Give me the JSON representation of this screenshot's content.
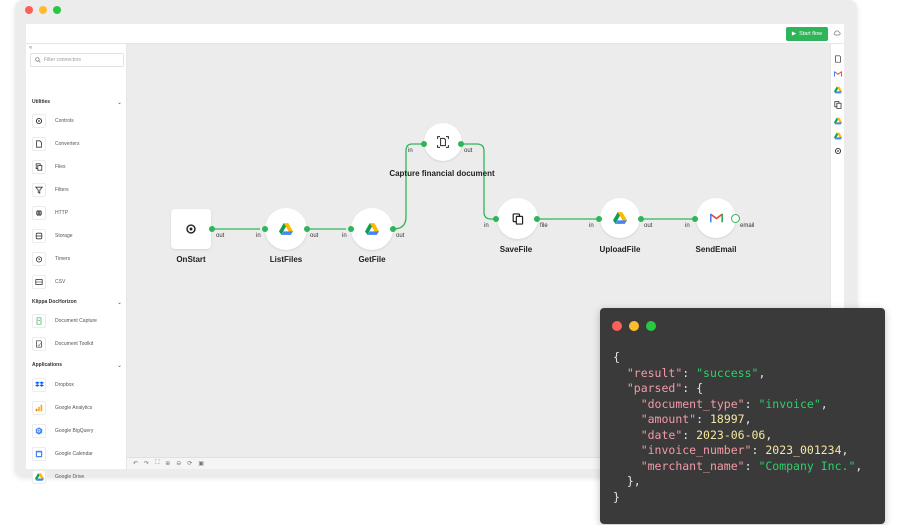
{
  "header": {
    "start_label": "Start flow"
  },
  "sidebar": {
    "search_placeholder": "Filter connectors",
    "sections": [
      {
        "label": "Utilities",
        "items": [
          {
            "label": "Controls",
            "icon": "gear-icon"
          },
          {
            "label": "Converters",
            "icon": "document-convert-icon"
          },
          {
            "label": "Files",
            "icon": "files-icon"
          },
          {
            "label": "Filters",
            "icon": "filter-icon"
          },
          {
            "label": "HTTP",
            "icon": "globe-icon"
          },
          {
            "label": "Storage",
            "icon": "database-icon"
          },
          {
            "label": "Timers",
            "icon": "clock-icon"
          },
          {
            "label": "CSV",
            "icon": "csv-icon"
          }
        ]
      },
      {
        "label": "Klippa DocHorizon",
        "items": [
          {
            "label": "Document Capture",
            "icon": "document-capture-icon"
          },
          {
            "label": "Document Toolkit",
            "icon": "document-toolkit-icon"
          }
        ]
      },
      {
        "label": "Applications",
        "items": [
          {
            "label": "Dropbox",
            "icon": "dropbox-icon"
          },
          {
            "label": "Google Analytics",
            "icon": "google-analytics-icon"
          },
          {
            "label": "Google BigQuery",
            "icon": "google-bigquery-icon"
          },
          {
            "label": "Google Calendar",
            "icon": "google-calendar-icon"
          },
          {
            "label": "Google Drive",
            "icon": "google-drive-icon"
          }
        ]
      }
    ]
  },
  "flow": {
    "nodes": {
      "onstart": {
        "title": "OnStart",
        "out": "out"
      },
      "listfiles": {
        "title": "ListFiles",
        "in": "in",
        "out": "out"
      },
      "getfile": {
        "title": "GetFile",
        "in": "in",
        "out": "out"
      },
      "capture": {
        "title": "Capture financial document",
        "in": "in",
        "out": "out"
      },
      "savefile": {
        "title": "SaveFile",
        "in": "in",
        "out": "file"
      },
      "uploadfile": {
        "title": "UploadFile",
        "in": "in",
        "out": "out"
      },
      "sendemail": {
        "title": "SendEmail",
        "in": "in",
        "out": "email"
      }
    },
    "colors": {
      "accent": "#2fb45a"
    }
  },
  "code": {
    "lines": [
      "{",
      "  \"result\": \"success\",",
      "  \"parsed\": {",
      "    \"document_type\": \"invoice\",",
      "    \"amount\": 18997,",
      "    \"date\": 2023-06-06,",
      "    \"invoice_number\": 2023_001234,",
      "    \"merchant_name\": \"Company Inc.\",",
      "  },",
      "}"
    ]
  }
}
